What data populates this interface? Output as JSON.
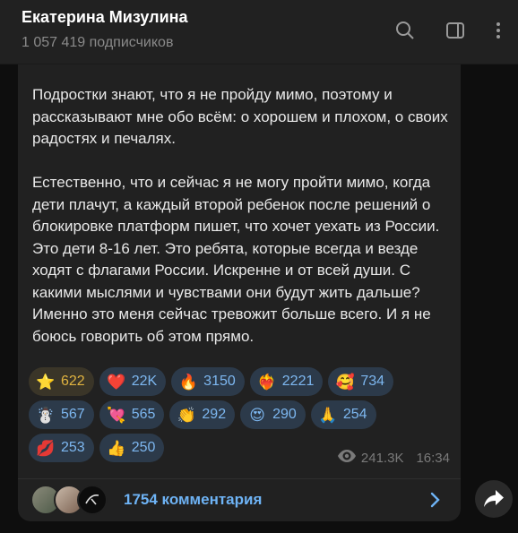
{
  "header": {
    "title": "Екатерина Мизулина",
    "subtitle": "1 057 419 подписчиков",
    "icons": [
      "search-icon",
      "sidebar-toggle-icon",
      "more-vertical-icon"
    ]
  },
  "post": {
    "text": "Подростки знают, что я не пройду мимо, поэтому и рассказывают мне обо всём: о хорошем и плохом, о своих радостях и печалях.\n\nЕстественно, что и сейчас я не могу пройти мимо, когда дети плачут, а каждый второй ребенок после решений о блокировке платформ пишет, что хочет уехать из России. Это дети 8-16 лет. Это ребята, которые всегда и везде ходят с флагами России. Искренне и от всей души. С какими мыслями и чувствами они будут жить дальше? Именно это меня сейчас тревожит больше всего. И я не боюсь говорить об этом прямо.",
    "reactions": [
      [
        {
          "emoji": "⭐",
          "count": "622",
          "name": "reaction-star"
        },
        {
          "emoji": "❤️",
          "count": "22K",
          "name": "reaction-heart"
        },
        {
          "emoji": "🔥",
          "count": "3150",
          "name": "reaction-fire"
        },
        {
          "emoji": "❤️‍🔥",
          "count": "2221",
          "name": "reaction-heart-on-fire"
        },
        {
          "emoji": "🥰",
          "count": "734",
          "name": "reaction-smiling-hearts"
        }
      ],
      [
        {
          "emoji": "☃️",
          "count": "567",
          "name": "reaction-snowman"
        },
        {
          "emoji": "💘",
          "count": "565",
          "name": "reaction-heart-arrow"
        },
        {
          "emoji": "👏",
          "count": "292",
          "name": "reaction-clap"
        },
        {
          "emoji": "😍",
          "count": "290",
          "name": "reaction-heart-eyes"
        },
        {
          "emoji": "🙏",
          "count": "254",
          "name": "reaction-pray"
        }
      ],
      [
        {
          "emoji": "💋",
          "count": "253",
          "name": "reaction-kiss"
        },
        {
          "emoji": "👍",
          "count": "250",
          "name": "reaction-thumbs-up"
        }
      ]
    ],
    "views": "241.3K",
    "time": "16:34"
  },
  "comments": {
    "label": "1754 комментария"
  },
  "colors": {
    "accent": "#6eb3f5",
    "reaction_bg": "#2c3a4a",
    "star_bg": "#3a3528",
    "star_text": "#e0b340"
  }
}
